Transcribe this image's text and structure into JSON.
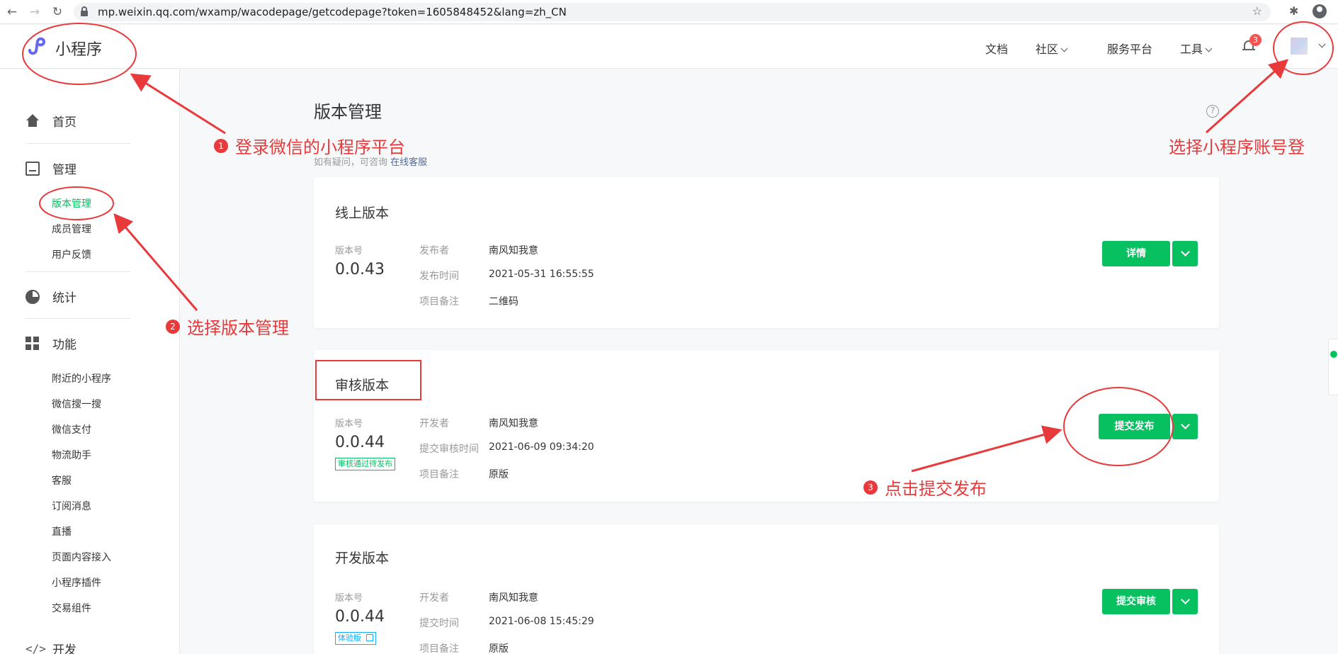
{
  "browser": {
    "url": "mp.weixin.qq.com/wxamp/wacodepage/getcodepage?token=1605848452&lang=zh_CN"
  },
  "header": {
    "logo_text": "小程序",
    "nav": [
      "文档",
      "社区",
      "服务平台",
      "工具"
    ],
    "notification_count": "3"
  },
  "sidebar": {
    "home": "首页",
    "manage": "管理",
    "manage_items": [
      "版本管理",
      "成员管理",
      "用户反馈"
    ],
    "stats": "统计",
    "features": "功能",
    "feature_items": [
      "附近的小程序",
      "微信搜一搜",
      "微信支付",
      "物流助手",
      "客服",
      "订阅消息",
      "直播",
      "页面内容接入",
      "小程序插件",
      "交易组件"
    ],
    "dev": "开发"
  },
  "page": {
    "title": "版本管理",
    "note_prefix": "如有疑问，可咨询",
    "note_link": "在线客服"
  },
  "cards": {
    "online": {
      "title": "线上版本",
      "ver_label": "版本号",
      "version": "0.0.43",
      "k1": "发布者",
      "v1": "南风知我意",
      "k2": "发布时间",
      "v2": "2021-05-31 16:55:55",
      "k3": "项目备注",
      "v3": "二维码",
      "button": "详情"
    },
    "review": {
      "title": "审核版本",
      "ver_label": "版本号",
      "version": "0.0.44",
      "tag": "审核通过待发布",
      "k1": "开发者",
      "v1": "南风知我意",
      "k2": "提交审核时间",
      "v2": "2021-06-09 09:34:20",
      "k3": "项目备注",
      "v3": "原版",
      "button": "提交发布"
    },
    "dev": {
      "title": "开发版本",
      "ver_label": "版本号",
      "version": "0.0.44",
      "tag": "体验版",
      "k1": "开发者",
      "v1": "南风知我意",
      "k2": "提交时间",
      "v2": "2021-06-08 15:45:29",
      "k3": "项目备注",
      "v3": "原版",
      "button": "提交审核"
    }
  },
  "annotations": {
    "a1_num": "1",
    "a1": "登录微信的小程序平台",
    "a2_num": "2",
    "a2": "选择版本管理",
    "a3_num": "3",
    "a3": "点击提交发布",
    "a4": "选择小程序账号登"
  },
  "colors": {
    "brand_green": "#07c160",
    "annotation_red": "#e8393b",
    "link_blue": "#576b95"
  }
}
